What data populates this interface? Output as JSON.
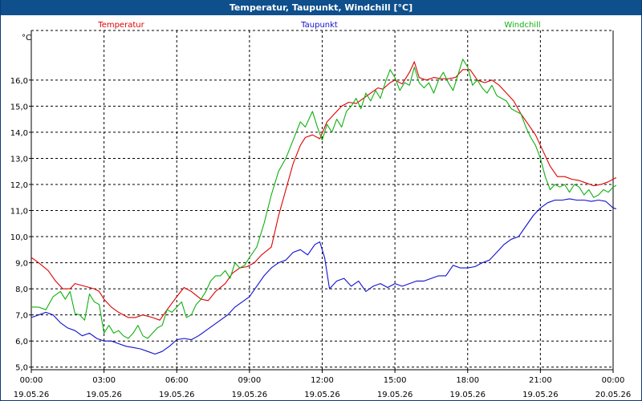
{
  "window": {
    "title": "Temperatur, Taupunkt, Windchill [°C]"
  },
  "chart_data": {
    "type": "line",
    "title": "Temperatur, Taupunkt, Windchill [°C]",
    "ylabel": "°C",
    "xlabel": "",
    "ylim": [
      4.9,
      17.9
    ],
    "xlim": [
      0,
      24
    ],
    "grid": true,
    "legend": "top",
    "yticks": [
      "5,0",
      "6,0",
      "7,0",
      "8,0",
      "9,0",
      "10,0",
      "11,0",
      "12,0",
      "13,0",
      "14,0",
      "15,0",
      "16,0"
    ],
    "yticks_values": [
      5,
      6,
      7,
      8,
      9,
      10,
      11,
      12,
      13,
      14,
      15,
      16
    ],
    "xticks": [
      {
        "time": "00:00",
        "date": "19.05.26"
      },
      {
        "time": "03:00",
        "date": "19.05.26"
      },
      {
        "time": "06:00",
        "date": "19.05.26"
      },
      {
        "time": "09:00",
        "date": "19.05.26"
      },
      {
        "time": "12:00",
        "date": "19.05.26"
      },
      {
        "time": "15:00",
        "date": "19.05.26"
      },
      {
        "time": "18:00",
        "date": "19.05.26"
      },
      {
        "time": "21:00",
        "date": "19.05.26"
      },
      {
        "time": "00:00",
        "date": "20.05.26"
      }
    ],
    "xticks_values": [
      0,
      3,
      6,
      9,
      12,
      15,
      18,
      21,
      24
    ],
    "series": [
      {
        "name": "Temperatur",
        "color": "#e00000",
        "points": [
          [
            0,
            9.2
          ],
          [
            0.3,
            9.0
          ],
          [
            0.7,
            8.7
          ],
          [
            1.0,
            8.3
          ],
          [
            1.3,
            8.0
          ],
          [
            1.6,
            8.0
          ],
          [
            1.8,
            8.2
          ],
          [
            2.2,
            8.1
          ],
          [
            2.6,
            8.0
          ],
          [
            2.8,
            7.9
          ],
          [
            3.0,
            7.6
          ],
          [
            3.3,
            7.3
          ],
          [
            3.6,
            7.1
          ],
          [
            4.0,
            6.9
          ],
          [
            4.3,
            6.9
          ],
          [
            4.6,
            7.0
          ],
          [
            5.0,
            6.9
          ],
          [
            5.3,
            6.8
          ],
          [
            5.6,
            7.2
          ],
          [
            6.0,
            7.7
          ],
          [
            6.3,
            8.05
          ],
          [
            6.6,
            7.9
          ],
          [
            7.0,
            7.6
          ],
          [
            7.3,
            7.55
          ],
          [
            7.6,
            7.9
          ],
          [
            8.0,
            8.2
          ],
          [
            8.3,
            8.6
          ],
          [
            8.6,
            8.8
          ],
          [
            8.9,
            8.85
          ],
          [
            9.2,
            9.0
          ],
          [
            9.5,
            9.3
          ],
          [
            9.9,
            9.6
          ],
          [
            10.2,
            10.8
          ],
          [
            10.5,
            11.8
          ],
          [
            10.8,
            12.8
          ],
          [
            11.1,
            13.5
          ],
          [
            11.3,
            13.8
          ],
          [
            11.6,
            13.9
          ],
          [
            11.9,
            13.75
          ],
          [
            12.2,
            14.4
          ],
          [
            12.5,
            14.7
          ],
          [
            12.8,
            15.0
          ],
          [
            13.1,
            15.15
          ],
          [
            13.4,
            15.1
          ],
          [
            13.7,
            15.3
          ],
          [
            14.0,
            15.5
          ],
          [
            14.3,
            15.7
          ],
          [
            14.5,
            15.65
          ],
          [
            14.8,
            15.9
          ],
          [
            15.0,
            16.0
          ],
          [
            15.3,
            15.85
          ],
          [
            15.6,
            16.3
          ],
          [
            15.8,
            16.7
          ],
          [
            16.0,
            16.1
          ],
          [
            16.3,
            16.0
          ],
          [
            16.6,
            16.1
          ],
          [
            16.9,
            16.05
          ],
          [
            17.2,
            16.05
          ],
          [
            17.5,
            16.1
          ],
          [
            17.8,
            16.4
          ],
          [
            18.1,
            16.4
          ],
          [
            18.4,
            16.0
          ],
          [
            18.7,
            15.9
          ],
          [
            19.0,
            16.0
          ],
          [
            19.3,
            15.8
          ],
          [
            19.6,
            15.5
          ],
          [
            19.9,
            15.2
          ],
          [
            20.2,
            14.7
          ],
          [
            20.5,
            14.3
          ],
          [
            20.8,
            13.9
          ],
          [
            21.1,
            13.3
          ],
          [
            21.4,
            12.7
          ],
          [
            21.7,
            12.3
          ],
          [
            22.0,
            12.3
          ],
          [
            22.3,
            12.2
          ],
          [
            22.6,
            12.15
          ],
          [
            22.9,
            12.05
          ],
          [
            23.2,
            11.95
          ],
          [
            23.5,
            12.0
          ],
          [
            23.8,
            12.1
          ],
          [
            24.1,
            12.25
          ],
          [
            24.4,
            12.2
          ]
        ]
      },
      {
        "name": "Taupunkt",
        "color": "#1010d0",
        "points": [
          [
            0,
            6.9
          ],
          [
            0.3,
            7.0
          ],
          [
            0.6,
            7.1
          ],
          [
            0.9,
            7.0
          ],
          [
            1.2,
            6.7
          ],
          [
            1.5,
            6.5
          ],
          [
            1.8,
            6.4
          ],
          [
            2.1,
            6.2
          ],
          [
            2.4,
            6.3
          ],
          [
            2.7,
            6.1
          ],
          [
            3.0,
            6.0
          ],
          [
            3.3,
            6.0
          ],
          [
            3.6,
            5.9
          ],
          [
            3.9,
            5.8
          ],
          [
            4.2,
            5.75
          ],
          [
            4.5,
            5.7
          ],
          [
            4.8,
            5.6
          ],
          [
            5.1,
            5.5
          ],
          [
            5.4,
            5.6
          ],
          [
            5.7,
            5.8
          ],
          [
            6.0,
            6.05
          ],
          [
            6.3,
            6.1
          ],
          [
            6.6,
            6.05
          ],
          [
            6.9,
            6.2
          ],
          [
            7.2,
            6.4
          ],
          [
            7.5,
            6.6
          ],
          [
            7.8,
            6.8
          ],
          [
            8.1,
            7.0
          ],
          [
            8.4,
            7.3
          ],
          [
            8.7,
            7.5
          ],
          [
            9.0,
            7.7
          ],
          [
            9.3,
            8.1
          ],
          [
            9.6,
            8.5
          ],
          [
            9.9,
            8.8
          ],
          [
            10.2,
            9.0
          ],
          [
            10.5,
            9.1
          ],
          [
            10.8,
            9.4
          ],
          [
            11.1,
            9.5
          ],
          [
            11.4,
            9.3
          ],
          [
            11.7,
            9.7
          ],
          [
            11.9,
            9.8
          ],
          [
            12.1,
            9.2
          ],
          [
            12.3,
            8.0
          ],
          [
            12.6,
            8.3
          ],
          [
            12.9,
            8.4
          ],
          [
            13.2,
            8.1
          ],
          [
            13.5,
            8.3
          ],
          [
            13.8,
            7.9
          ],
          [
            14.1,
            8.1
          ],
          [
            14.4,
            8.2
          ],
          [
            14.7,
            8.05
          ],
          [
            15.0,
            8.2
          ],
          [
            15.3,
            8.1
          ],
          [
            15.6,
            8.2
          ],
          [
            15.9,
            8.3
          ],
          [
            16.2,
            8.3
          ],
          [
            16.5,
            8.4
          ],
          [
            16.8,
            8.5
          ],
          [
            17.1,
            8.5
          ],
          [
            17.4,
            8.9
          ],
          [
            17.7,
            8.8
          ],
          [
            18.0,
            8.8
          ],
          [
            18.3,
            8.85
          ],
          [
            18.6,
            9.0
          ],
          [
            18.9,
            9.1
          ],
          [
            19.2,
            9.4
          ],
          [
            19.5,
            9.7
          ],
          [
            19.8,
            9.9
          ],
          [
            20.1,
            10.0
          ],
          [
            20.4,
            10.4
          ],
          [
            20.7,
            10.8
          ],
          [
            21.0,
            11.1
          ],
          [
            21.3,
            11.3
          ],
          [
            21.6,
            11.4
          ],
          [
            21.9,
            11.4
          ],
          [
            22.2,
            11.45
          ],
          [
            22.5,
            11.4
          ],
          [
            22.8,
            11.4
          ],
          [
            23.1,
            11.35
          ],
          [
            23.4,
            11.4
          ],
          [
            23.7,
            11.35
          ],
          [
            24.0,
            11.1
          ],
          [
            24.4,
            11.0
          ]
        ]
      },
      {
        "name": "Windchill",
        "color": "#10b010",
        "points": [
          [
            0,
            7.3
          ],
          [
            0.3,
            7.3
          ],
          [
            0.6,
            7.2
          ],
          [
            0.9,
            7.7
          ],
          [
            1.2,
            7.9
          ],
          [
            1.4,
            7.6
          ],
          [
            1.6,
            7.9
          ],
          [
            1.8,
            7.05
          ],
          [
            2.0,
            7.0
          ],
          [
            2.2,
            6.8
          ],
          [
            2.4,
            7.8
          ],
          [
            2.6,
            7.5
          ],
          [
            2.8,
            7.4
          ],
          [
            3.0,
            6.3
          ],
          [
            3.2,
            6.6
          ],
          [
            3.4,
            6.3
          ],
          [
            3.6,
            6.4
          ],
          [
            3.8,
            6.2
          ],
          [
            4.0,
            6.1
          ],
          [
            4.2,
            6.3
          ],
          [
            4.4,
            6.6
          ],
          [
            4.6,
            6.2
          ],
          [
            4.8,
            6.1
          ],
          [
            5.0,
            6.3
          ],
          [
            5.2,
            6.5
          ],
          [
            5.4,
            6.6
          ],
          [
            5.6,
            7.2
          ],
          [
            5.8,
            7.1
          ],
          [
            6.0,
            7.3
          ],
          [
            6.2,
            7.5
          ],
          [
            6.4,
            6.9
          ],
          [
            6.6,
            7.0
          ],
          [
            6.8,
            7.4
          ],
          [
            7.0,
            7.6
          ],
          [
            7.2,
            7.9
          ],
          [
            7.4,
            8.3
          ],
          [
            7.6,
            8.5
          ],
          [
            7.8,
            8.5
          ],
          [
            8.0,
            8.7
          ],
          [
            8.2,
            8.4
          ],
          [
            8.4,
            9.0
          ],
          [
            8.6,
            8.8
          ],
          [
            8.8,
            8.9
          ],
          [
            9.0,
            9.2
          ],
          [
            9.3,
            9.6
          ],
          [
            9.6,
            10.5
          ],
          [
            9.9,
            11.6
          ],
          [
            10.2,
            12.5
          ],
          [
            10.5,
            13.0
          ],
          [
            10.8,
            13.7
          ],
          [
            11.1,
            14.4
          ],
          [
            11.3,
            14.2
          ],
          [
            11.6,
            14.8
          ],
          [
            11.8,
            14.2
          ],
          [
            12.0,
            13.7
          ],
          [
            12.2,
            14.3
          ],
          [
            12.4,
            14.0
          ],
          [
            12.6,
            14.5
          ],
          [
            12.8,
            14.2
          ],
          [
            13.0,
            14.8
          ],
          [
            13.2,
            15.0
          ],
          [
            13.4,
            15.3
          ],
          [
            13.6,
            14.9
          ],
          [
            13.8,
            15.5
          ],
          [
            14.0,
            15.2
          ],
          [
            14.2,
            15.6
          ],
          [
            14.4,
            15.3
          ],
          [
            14.6,
            15.9
          ],
          [
            14.8,
            16.4
          ],
          [
            15.0,
            16.1
          ],
          [
            15.2,
            15.6
          ],
          [
            15.4,
            15.9
          ],
          [
            15.6,
            15.8
          ],
          [
            15.8,
            16.5
          ],
          [
            16.0,
            15.9
          ],
          [
            16.2,
            15.7
          ],
          [
            16.4,
            15.9
          ],
          [
            16.6,
            15.5
          ],
          [
            16.8,
            16.0
          ],
          [
            17.0,
            16.3
          ],
          [
            17.2,
            15.9
          ],
          [
            17.4,
            15.6
          ],
          [
            17.6,
            16.2
          ],
          [
            17.8,
            16.8
          ],
          [
            18.0,
            16.5
          ],
          [
            18.2,
            15.8
          ],
          [
            18.4,
            16.0
          ],
          [
            18.6,
            15.7
          ],
          [
            18.8,
            15.5
          ],
          [
            19.0,
            15.8
          ],
          [
            19.2,
            15.4
          ],
          [
            19.4,
            15.3
          ],
          [
            19.6,
            15.2
          ],
          [
            19.8,
            14.9
          ],
          [
            20.0,
            14.8
          ],
          [
            20.2,
            14.7
          ],
          [
            20.4,
            14.2
          ],
          [
            20.6,
            13.8
          ],
          [
            20.8,
            13.5
          ],
          [
            21.0,
            13.0
          ],
          [
            21.2,
            12.3
          ],
          [
            21.4,
            11.8
          ],
          [
            21.6,
            12.0
          ],
          [
            21.8,
            11.9
          ],
          [
            22.0,
            12.0
          ],
          [
            22.2,
            11.7
          ],
          [
            22.4,
            12.0
          ],
          [
            22.6,
            11.9
          ],
          [
            22.8,
            11.6
          ],
          [
            23.0,
            11.8
          ],
          [
            23.2,
            11.5
          ],
          [
            23.4,
            11.6
          ],
          [
            23.6,
            11.8
          ],
          [
            23.8,
            11.7
          ],
          [
            24.0,
            11.9
          ],
          [
            24.2,
            12.0
          ],
          [
            24.4,
            12.0
          ]
        ]
      }
    ]
  }
}
